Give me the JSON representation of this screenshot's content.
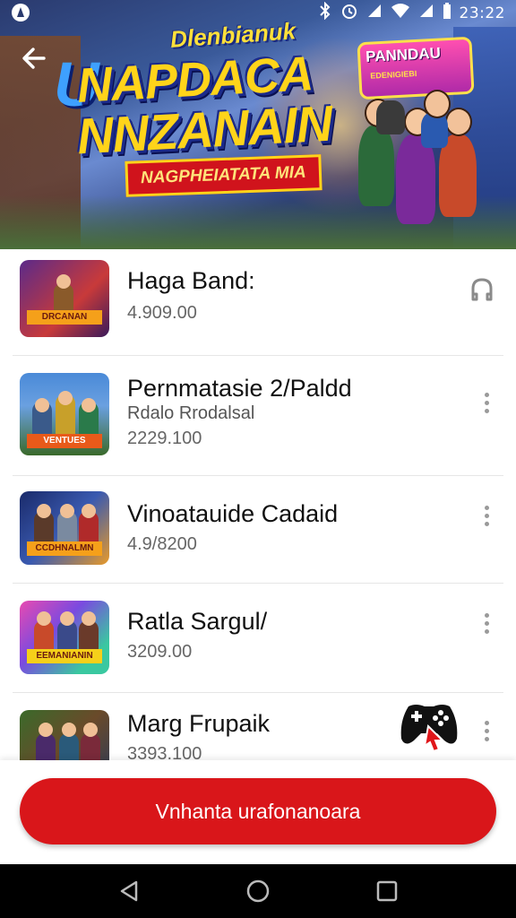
{
  "status_bar": {
    "time": "23:22",
    "icons": [
      "app-notification-icon",
      "bluetooth-icon",
      "alarm-icon",
      "signal-icon",
      "wifi-icon",
      "signal-icon",
      "battery-icon"
    ]
  },
  "banner": {
    "top_text": "Dlenbianuk",
    "title_line1": "NAPDACA",
    "title_line2": "NNZANAIN",
    "title_first_letter": "U",
    "subtitle": "NAGPHEIATATA MIA",
    "logo_title": "PANNDAU",
    "logo_sub": "EDENIGIEBI"
  },
  "games": [
    {
      "name": "Haga Band:",
      "sub": "",
      "price": "4.909.00",
      "thumb_label": "DRCANAN",
      "action_icon": "headphones-icon"
    },
    {
      "name": "Pernmatasie 2/Paldd",
      "sub": "Rdalo Rrodalsal",
      "price": "2229.100",
      "thumb_label": "VENTUES",
      "action_icon": "more-vert-icon"
    },
    {
      "name": "Vinoatauide Cadaid",
      "sub": "",
      "price": "4.9/8200",
      "thumb_label": "CCDHNALMN",
      "action_icon": "more-vert-icon"
    },
    {
      "name": "Ratla Sargul/",
      "sub": "",
      "price": "3209.00",
      "thumb_label": "EEMANIANIN",
      "action_icon": "more-vert-icon"
    },
    {
      "name": "Marg Frupaik",
      "sub": "",
      "price": "3393.100",
      "thumb_label": "",
      "action_icon": "more-vert-icon"
    }
  ],
  "cta": {
    "label": "Vnhanta urafonanoara"
  },
  "nav": {
    "icons": [
      "back-triangle-icon",
      "home-circle-icon",
      "recents-square-icon"
    ]
  },
  "colors": {
    "accent": "#d9161a",
    "title_yellow": "#ffd41a",
    "banner_blue": "#2d3f7a"
  }
}
